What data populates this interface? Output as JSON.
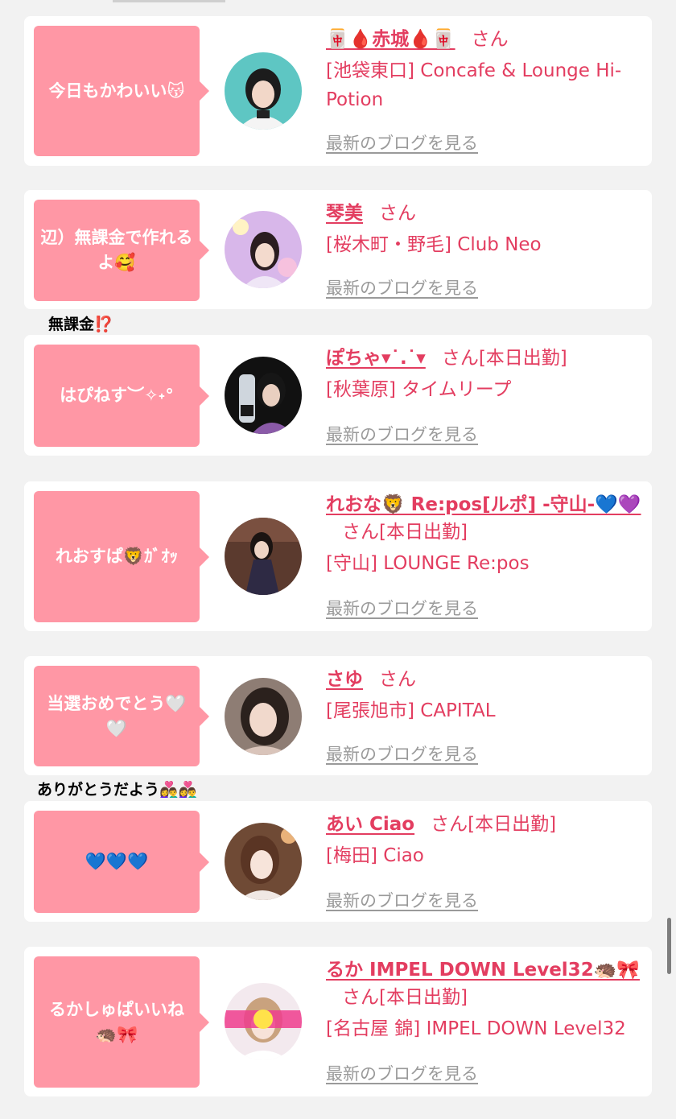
{
  "colors": {
    "bubble": "#ff97a5",
    "accent": "#e33d60",
    "link_gray": "#9a9a9a",
    "background": "#f2f2f2"
  },
  "cards": [
    {
      "comment": "今日もかわいい😽",
      "name": "🀄️🩸赤城🩸🀄️",
      "suffix": "さん",
      "shop": "[池袋東口] Concafe & Lounge Hi-Potion",
      "blog_link": "最新のブログを見る",
      "avatar_icon": "avatar-photo"
    },
    {
      "comment": "辺）無課金で作れるよ🥰",
      "name": "琴美",
      "suffix": "さん",
      "shop": "[桜木町・野毛] Club Neo",
      "blog_link": "最新のブログを見る",
      "avatar_icon": "avatar-photo"
    },
    {
      "comment": "はぴねす︶✧˖°",
      "name": "ぽちゃ▾˙.˙▾",
      "suffix": "さん[本日出勤]",
      "shop": "[秋葉原] タイムリープ",
      "blog_link": "最新のブログを見る",
      "avatar_icon": "avatar-photo"
    },
    {
      "comment": "れおすぱ🦁ｶﾞｵｯ",
      "name": "れおな🦁 Re:pos[ルポ] -守山-💙💜",
      "suffix": "さん[本日出勤]",
      "shop": "[守山] LOUNGE Re:pos",
      "blog_link": "最新のブログを見る",
      "avatar_icon": "avatar-photo"
    },
    {
      "comment": "当選おめでとう🤍🤍",
      "name": "さゆ",
      "suffix": "さん",
      "shop": "[尾張旭市] CAPITAL",
      "blog_link": "最新のブログを見る",
      "avatar_icon": "avatar-photo"
    },
    {
      "comment": "💙💙💙",
      "name": "あい Ciao",
      "suffix": "さん[本日出勤]",
      "shop": "[梅田] Ciao",
      "blog_link": "最新のブログを見る",
      "avatar_icon": "avatar-photo"
    },
    {
      "comment": "るかしゅぱいいね🦔🎀",
      "name": "るか IMPEL DOWN Level32🦔🎀",
      "suffix": "さん[本日出勤]",
      "shop": "[名古屋 錦] IMPEL DOWN Level32",
      "blog_link": "最新のブログを見る",
      "avatar_icon": "avatar-photo"
    }
  ],
  "captions": [
    "無課金⁉️",
    "ありがとうだよう👩‍❤️‍👨👩‍❤️‍👨"
  ]
}
